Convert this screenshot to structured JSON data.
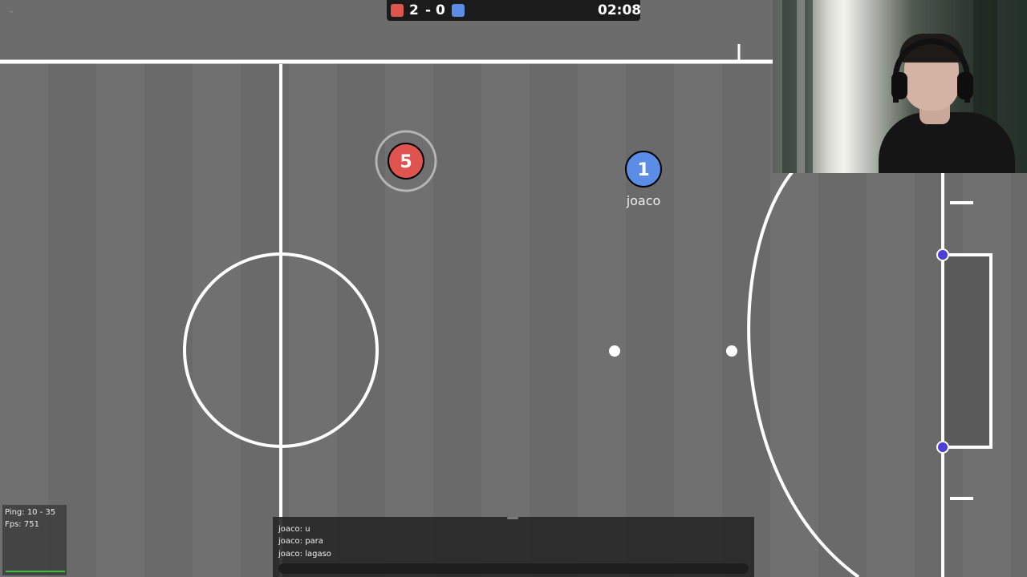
{
  "colors": {
    "red_team": "#e0544f",
    "blue_team": "#5b8ce6",
    "field": "#6e6e6e",
    "lines": "#ffffff",
    "post": "#4b3fd8"
  },
  "score": {
    "red": "2",
    "separator": "-",
    "blue": "0",
    "clock": "02:08"
  },
  "players": [
    {
      "number": "5",
      "team": "red",
      "name": ""
    },
    {
      "number": "1",
      "team": "blue",
      "name": "joaco"
    }
  ],
  "stats": {
    "ping": "Ping: 10 - 35",
    "fps": "Fps: 751"
  },
  "chat": {
    "messages": [
      "joaco: u",
      "joaco: para",
      "joaco: lagaso"
    ],
    "input_value": ""
  },
  "icons": {
    "menu": "chevron-down-icon"
  }
}
